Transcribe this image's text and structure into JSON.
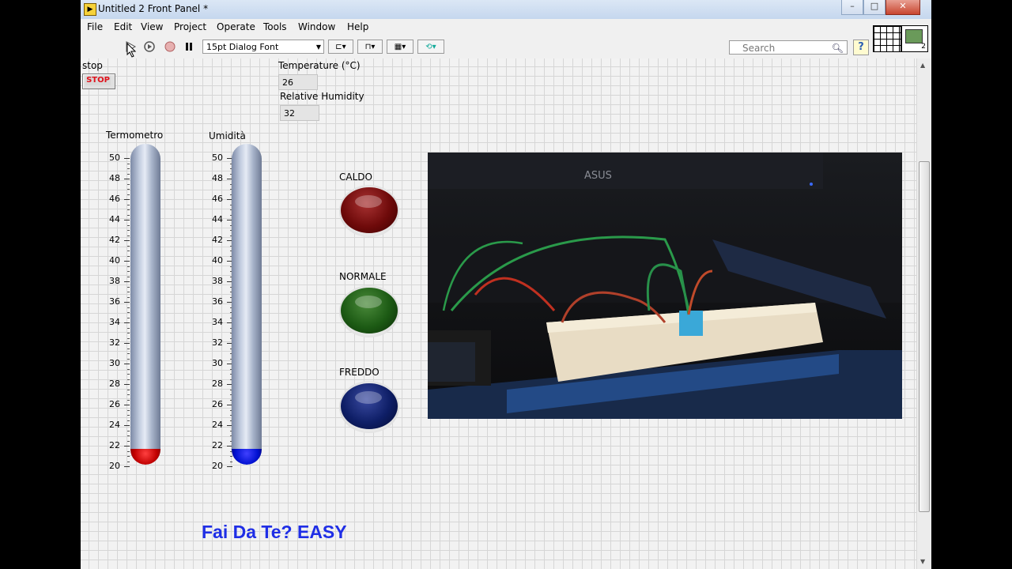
{
  "window": {
    "title": "Untitled 2 Front Panel *",
    "controls": [
      "–",
      "□",
      "✕"
    ]
  },
  "menu": [
    "File",
    "Edit",
    "View",
    "Project",
    "Operate",
    "Tools",
    "Window",
    "Help"
  ],
  "toolbar": {
    "font_select": "15pt Dialog Font",
    "search_placeholder": "Search",
    "help_label": "?"
  },
  "vi_icon_number": "2",
  "panel": {
    "stop_label": "stop",
    "stop_button": "STOP",
    "temperature_label": "Temperature (°C)",
    "temperature_value": "26",
    "humidity_label": "Relative Humidity",
    "humidity_value": "32",
    "termometro_label": "Termometro",
    "umidita_label": "Umidità",
    "scale_ticks": [
      "50",
      "48",
      "46",
      "44",
      "42",
      "40",
      "38",
      "36",
      "34",
      "32",
      "30",
      "28",
      "26",
      "24",
      "22",
      "20"
    ],
    "caldo_label": "CALDO",
    "normale_label": "NORMALE",
    "freddo_label": "FREDDO",
    "footer": "Fai Da Te? EASY"
  },
  "photo": {
    "monitor_brand": "ASUS"
  },
  "colors": {
    "termometro_fill": "#e00000",
    "umidita_fill": "#0010e0",
    "caldo_led": "#6e0a0a",
    "normale_led": "#1c5a14",
    "freddo_led": "#0e1e66",
    "footer_text": "#1f2ee6"
  }
}
